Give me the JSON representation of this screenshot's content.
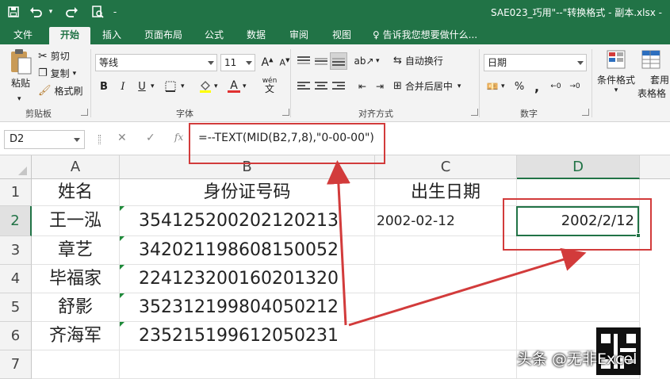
{
  "titlebar": {
    "title": "SAE023_巧用\"--\"转换格式 - 副本.xlsx -"
  },
  "tabs": [
    {
      "label": "文件"
    },
    {
      "label": "开始"
    },
    {
      "label": "插入"
    },
    {
      "label": "页面布局"
    },
    {
      "label": "公式"
    },
    {
      "label": "数据"
    },
    {
      "label": "审阅"
    },
    {
      "label": "视图"
    }
  ],
  "tell_me": "告诉我您想要做什么...",
  "ribbon": {
    "clipboard": {
      "paste": "粘贴",
      "cut": "剪切",
      "copy": "复制",
      "format_painter": "格式刷",
      "group": "剪贴板"
    },
    "font": {
      "name": "等线",
      "size": "11",
      "bold": "B",
      "italic": "I",
      "underline": "U",
      "font_color_label": "A",
      "phonetic": "wén",
      "group": "字体"
    },
    "alignment": {
      "wrap": "自动换行",
      "merge": "合并后居中",
      "group": "对齐方式"
    },
    "number": {
      "format": "日期",
      "percent": "%",
      "comma": ",",
      "inc_dec1": "←0",
      "inc_dec2": "→0",
      "group": "数字"
    },
    "styles": {
      "conditional": "条件格式",
      "table1": "套用",
      "table2": "表格格"
    }
  },
  "formula_bar": {
    "cell_ref": "D2",
    "fx": "fx",
    "formula": "=--TEXT(MID(B2,7,8),\"0-00-00\")"
  },
  "sheet": {
    "columns": [
      "A",
      "B",
      "C",
      "D"
    ],
    "rows": [
      "1",
      "2",
      "3",
      "4",
      "5",
      "6",
      "7"
    ],
    "headers": {
      "A": "姓名",
      "B": "身份证号码",
      "C": "出生日期"
    },
    "data": [
      {
        "name": "王一泓",
        "id": "354125200202120213",
        "birth": "2002-02-12",
        "converted": "2002/2/12"
      },
      {
        "name": "章艺",
        "id": "342021198608150052"
      },
      {
        "name": "毕福家",
        "id": "224123200160201320"
      },
      {
        "name": "舒影",
        "id": "352312199804050212"
      },
      {
        "name": "齐海军",
        "id": "235215199612050231"
      }
    ]
  },
  "watermark": "头条 @无非Excel",
  "colors": {
    "excel_green": "#217346",
    "annotation_red": "#d23b3b"
  }
}
